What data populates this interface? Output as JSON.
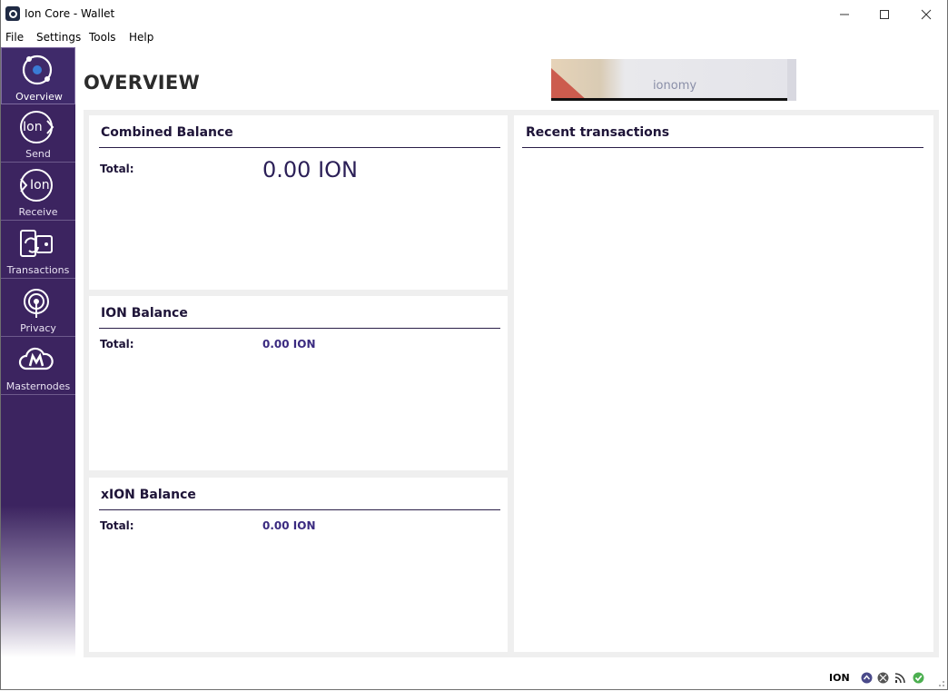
{
  "window": {
    "title": "Ion Core - Wallet"
  },
  "menu": [
    "File",
    "Settings",
    "Tools",
    "Help"
  ],
  "sidebar": {
    "items": [
      {
        "label": "Overview",
        "icon": "overview-icon",
        "active": true
      },
      {
        "label": "Send",
        "icon": "send-icon"
      },
      {
        "label": "Receive",
        "icon": "receive-icon"
      },
      {
        "label": "Transactions",
        "icon": "transactions-icon"
      },
      {
        "label": "Privacy",
        "icon": "privacy-icon"
      },
      {
        "label": "Masternodes",
        "icon": "masternodes-icon"
      }
    ],
    "send_icon_text": "Ion",
    "receive_icon_text": "Ion"
  },
  "main": {
    "title": "OVERVIEW",
    "logo_text": "ionomy",
    "combined": {
      "title": "Combined Balance",
      "total_label": "Total:",
      "total_value": "0.00 ION"
    },
    "ion": {
      "title": "ION Balance",
      "total_label": "Total:",
      "total_value": "0.00 ION"
    },
    "xion": {
      "title": "xION Balance",
      "total_label": "Total:",
      "total_value": "0.00 ION"
    },
    "recent": {
      "title": "Recent transactions"
    }
  },
  "statusbar": {
    "unit": "ION",
    "icons": [
      "staking-icon",
      "zerocoin-icon",
      "connections-icon",
      "synced-icon"
    ]
  },
  "colors": {
    "sidebar": "#3c2460",
    "accent": "#2b1f57",
    "synced": "#4caf50"
  }
}
